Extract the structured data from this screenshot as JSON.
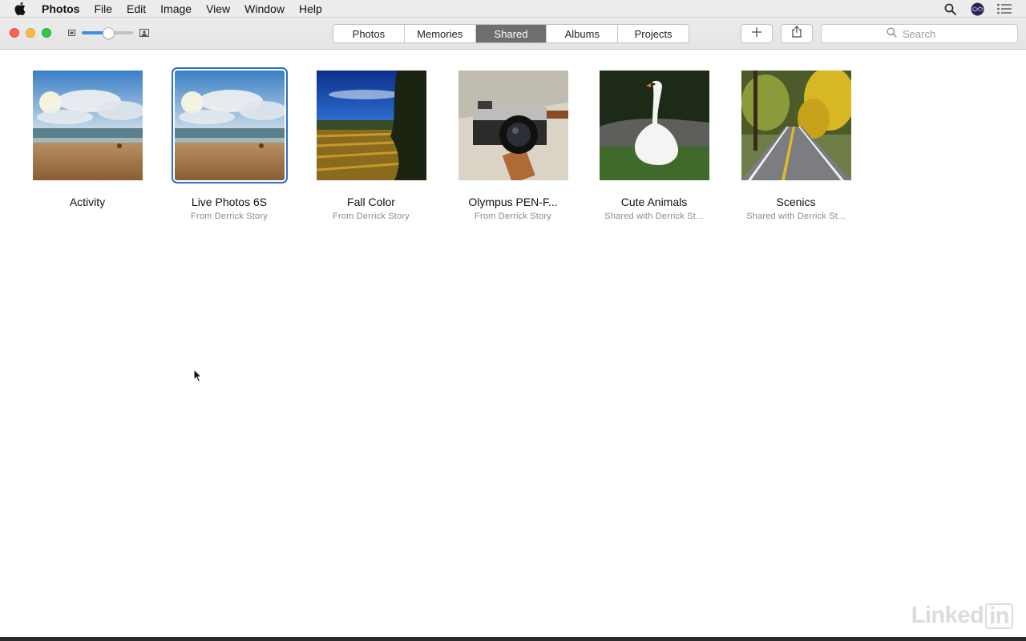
{
  "menubar": {
    "apple_icon": "apple-logo-icon",
    "app_name": "Photos",
    "items": [
      "File",
      "Edit",
      "Image",
      "View",
      "Window",
      "Help"
    ],
    "right_icons": [
      "spotlight-search-icon",
      "siri-icon",
      "notification-center-icon"
    ]
  },
  "toolbar": {
    "traffic_lights": [
      "close",
      "minimize",
      "zoom"
    ],
    "zoom_slider_level": 0.5,
    "tabs": [
      {
        "label": "Photos",
        "active": false
      },
      {
        "label": "Memories",
        "active": false
      },
      {
        "label": "Shared",
        "active": true
      },
      {
        "label": "Albums",
        "active": false
      },
      {
        "label": "Projects",
        "active": false
      }
    ],
    "add_icon": "plus-icon",
    "share_icon": "share-icon",
    "search_placeholder": "Search"
  },
  "albums": [
    {
      "title": "Activity",
      "subtitle": "",
      "image": "beach-sky",
      "selected": false
    },
    {
      "title": "Live Photos 6S",
      "subtitle": "From Derrick Story",
      "image": "beach-sky",
      "selected": true
    },
    {
      "title": "Fall Color",
      "subtitle": "From Derrick Story",
      "image": "vineyard",
      "selected": false
    },
    {
      "title": "Olympus PEN-F...",
      "subtitle": "From Derrick Story",
      "image": "camera",
      "selected": false
    },
    {
      "title": "Cute Animals",
      "subtitle": "Shared with Derrick St...",
      "image": "swan",
      "selected": false
    },
    {
      "title": "Scenics",
      "subtitle": "Shared with Derrick St...",
      "image": "road",
      "selected": false
    }
  ],
  "watermark": {
    "text": "Linked",
    "box": "in"
  },
  "colors": {
    "accent": "#2d6cc9",
    "active_tab": "#6e6e6e"
  }
}
